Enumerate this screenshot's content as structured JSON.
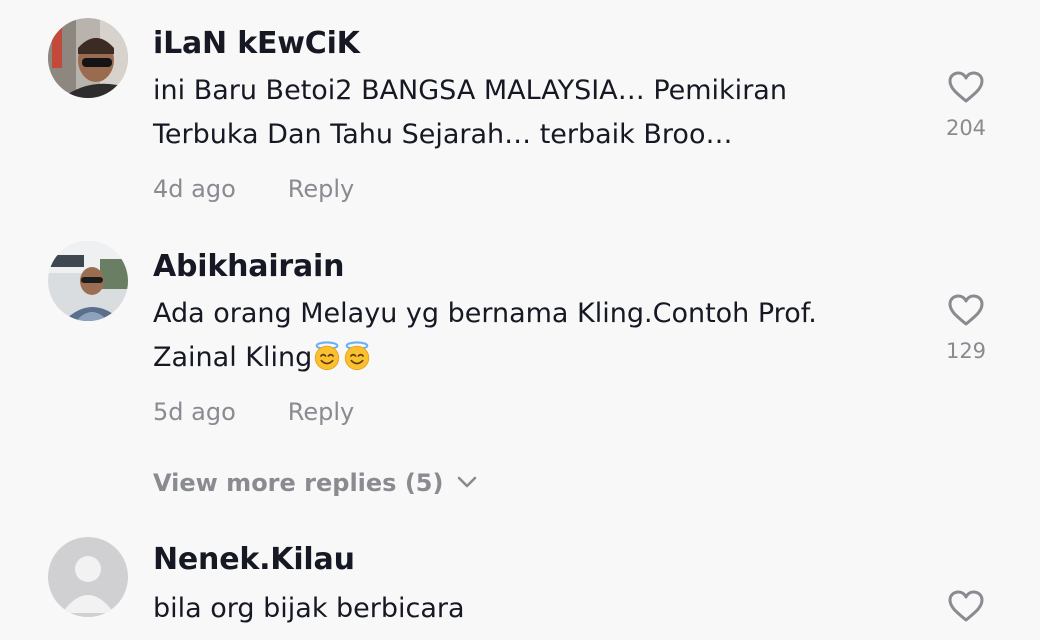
{
  "comments": [
    {
      "username": "iLaN kEwCiK",
      "text_lines": [
        "ini Baru Betoi2 BANGSA MALAYSIA… Pemikiran",
        "Terbuka Dan Tahu Sejarah… terbaik Broo…"
      ],
      "time": "4d ago",
      "reply_label": "Reply",
      "likes": "204",
      "avatar_icon": "user-photo-avatar"
    },
    {
      "username": "Abikhairain",
      "text_lines": [
        "Ada orang Melayu yg bernama Kling.Contoh Prof.",
        "Zainal Kling"
      ],
      "emoji": [
        "smiling-face-with-halo",
        "smiling-face-with-halo"
      ],
      "time": "5d ago",
      "reply_label": "Reply",
      "likes": "129",
      "avatar_icon": "user-photo-avatar"
    },
    {
      "username": "Nenek.Kilau",
      "text_lines": [
        "bila org bijak berbicara"
      ],
      "avatar_icon": "default-avatar"
    }
  ],
  "view_more": {
    "label": "View more replies (5)",
    "icon": "chevron-down-icon"
  },
  "colors": {
    "background": "#f8f8f8",
    "text_primary": "#161823",
    "text_secondary": "#8a8b91"
  }
}
